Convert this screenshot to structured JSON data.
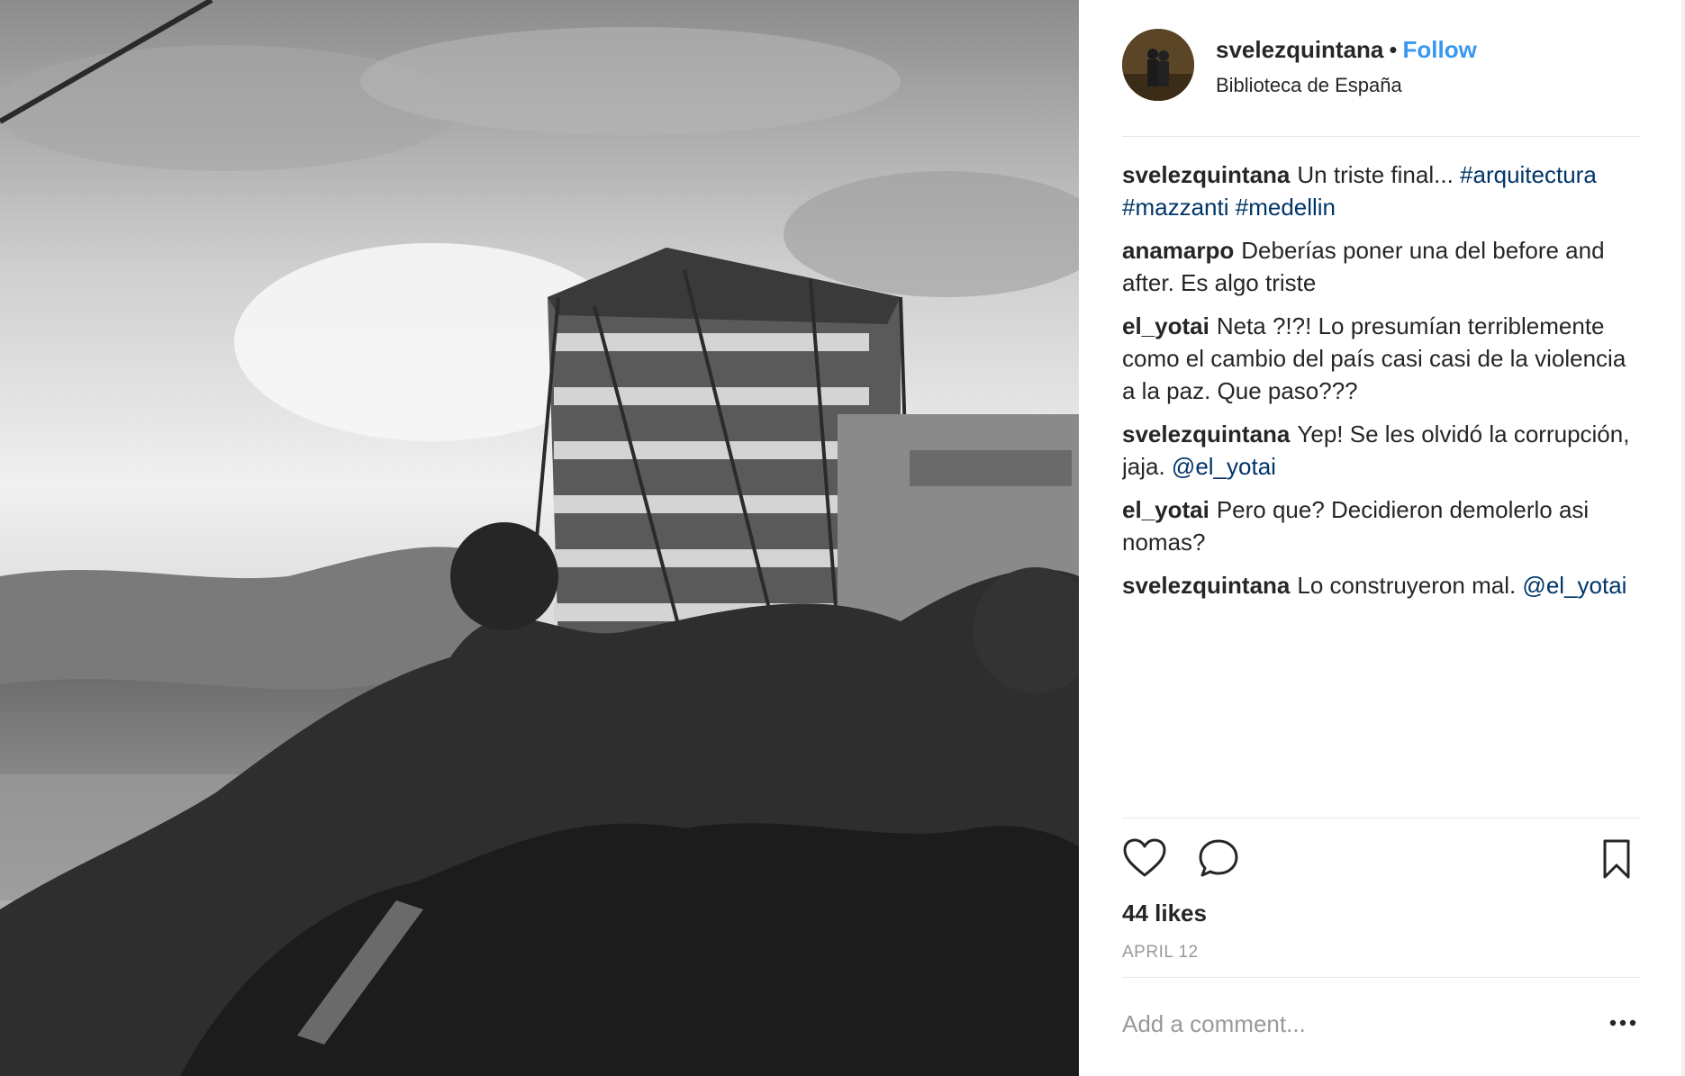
{
  "post": {
    "username": "svelezquintana",
    "separator": "•",
    "follow_label": "Follow",
    "location": "Biblioteca de España",
    "likes": "44 likes",
    "date": "APRIL 12"
  },
  "comments": [
    {
      "user": "svelezquintana",
      "parts": [
        {
          "text": "Un triste final... ",
          "type": "text"
        },
        {
          "text": "#arquitectura",
          "type": "tag"
        },
        {
          "text": " ",
          "type": "text"
        },
        {
          "text": "#mazzanti",
          "type": "tag"
        },
        {
          "text": " ",
          "type": "text"
        },
        {
          "text": "#medellin",
          "type": "tag"
        }
      ]
    },
    {
      "user": "anamarpo",
      "parts": [
        {
          "text": "Deberías poner una del before and after. Es algo triste",
          "type": "text"
        }
      ]
    },
    {
      "user": "el_yotai",
      "parts": [
        {
          "text": "Neta ?!?! Lo presumían terriblemente como el cambio del país casi casi de la violencia a la paz. Que paso???",
          "type": "text"
        }
      ]
    },
    {
      "user": "svelezquintana",
      "parts": [
        {
          "text": "Yep! Se les olvidó la corrupción, jaja. ",
          "type": "text"
        },
        {
          "text": "@el_yotai",
          "type": "tag"
        }
      ]
    },
    {
      "user": "el_yotai",
      "parts": [
        {
          "text": "Pero que? Decidieron demolerlo asi nomas?",
          "type": "text"
        }
      ]
    },
    {
      "user": "svelezquintana",
      "parts": [
        {
          "text": "Lo construyeron mal. ",
          "type": "text"
        },
        {
          "text": "@el_yotai",
          "type": "tag"
        }
      ]
    }
  ],
  "add_comment_placeholder": "Add a comment...",
  "icons": {
    "like": "heart-icon",
    "comment": "comment-bubble-icon",
    "save": "bookmark-icon",
    "more": "more-options-icon"
  },
  "colors": {
    "follow": "#3897f0",
    "tag": "#003569",
    "muted": "#999999",
    "text": "#262626"
  }
}
